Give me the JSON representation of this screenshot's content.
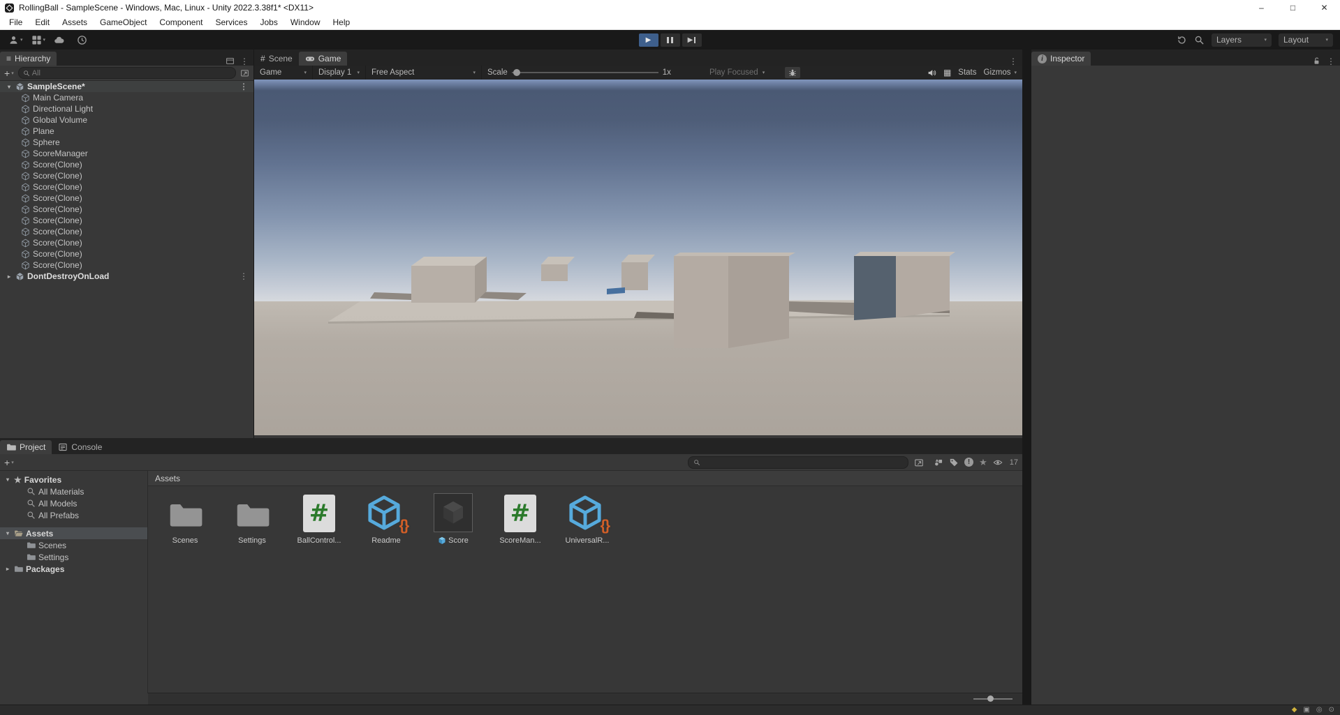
{
  "window": {
    "title": "RollingBall - SampleScene - Windows, Mac, Linux - Unity 2022.3.38f1* <DX11>"
  },
  "menu": [
    "File",
    "Edit",
    "Assets",
    "GameObject",
    "Component",
    "Services",
    "Jobs",
    "Window",
    "Help"
  ],
  "topbar": {
    "layers": "Layers",
    "layout": "Layout"
  },
  "hierarchy": {
    "tab": "Hierarchy",
    "search_value": "All",
    "scene_label": "SampleScene*",
    "items": [
      "Main Camera",
      "Directional Light",
      "Global Volume",
      "Plane",
      "Sphere",
      "ScoreManager",
      "Score(Clone)",
      "Score(Clone)",
      "Score(Clone)",
      "Score(Clone)",
      "Score(Clone)",
      "Score(Clone)",
      "Score(Clone)",
      "Score(Clone)",
      "Score(Clone)",
      "Score(Clone)"
    ],
    "extra_scene_label": "DontDestroyOnLoad"
  },
  "viewtabs": {
    "scene": "Scene",
    "game": "Game"
  },
  "game_toolbar": {
    "mode": "Game",
    "display": "Display 1",
    "aspect": "Free Aspect",
    "scale_label": "Scale",
    "scale_value": "1x",
    "play_focused": "Play Focused",
    "stats": "Stats",
    "gizmos": "Gizmos"
  },
  "inspector": {
    "tab": "Inspector"
  },
  "project": {
    "tab_project": "Project",
    "tab_console": "Console",
    "tree": [
      {
        "label": "Favorites",
        "icon": "star",
        "bold": true,
        "exp": "open",
        "indent": 0
      },
      {
        "label": "All Materials",
        "icon": "search",
        "indent": 1
      },
      {
        "label": "All Models",
        "icon": "search",
        "indent": 1
      },
      {
        "label": "All Prefabs",
        "icon": "search",
        "indent": 1
      },
      {
        "label": "Assets",
        "icon": "folder-open",
        "bold": true,
        "exp": "open",
        "indent": 0,
        "selected": true,
        "gap": true
      },
      {
        "label": "Scenes",
        "icon": "folder",
        "indent": 1
      },
      {
        "label": "Settings",
        "icon": "folder",
        "indent": 1
      },
      {
        "label": "Packages",
        "icon": "folder",
        "bold": true,
        "exp": "closed",
        "indent": 0
      }
    ],
    "files_header": "Assets",
    "assets": [
      {
        "label": "Scenes",
        "type": "folder"
      },
      {
        "label": "Settings",
        "type": "folder"
      },
      {
        "label": "BallControl...",
        "type": "csharp"
      },
      {
        "label": "Readme",
        "type": "scriptable"
      },
      {
        "label": "Score",
        "type": "prefab"
      },
      {
        "label": "ScoreMan...",
        "type": "csharp"
      },
      {
        "label": "UniversalR...",
        "type": "scriptable"
      }
    ],
    "eye_count": "17"
  },
  "colors": {
    "play_active": "#3e5f8c",
    "tree_selection": "#4a4d50",
    "script_green": "#2b7a2b",
    "asset_cube_blue": "#56aadc",
    "asset_braces_orange": "#d35f27"
  }
}
